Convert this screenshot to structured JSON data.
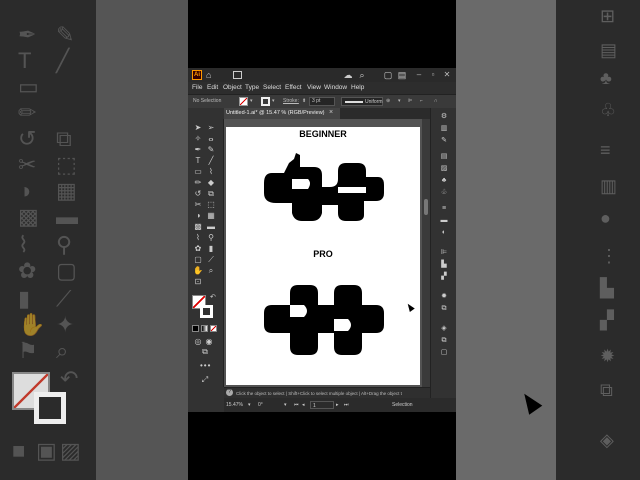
{
  "app": {
    "logo": "Ai",
    "menu": [
      "File",
      "Edit",
      "Object",
      "Type",
      "Select",
      "Effect",
      "View",
      "Window",
      "Help"
    ],
    "control_bar": {
      "selection_label": "No Selection",
      "stroke_label": "Stroke:",
      "stroke_value": "3 pt",
      "profile_label": "Uniform"
    },
    "document_tab": {
      "label": "Untitled-1.ai* @ 15.47 % (RGB/Preview)",
      "close": "×"
    },
    "artboard": {
      "heading_top": "BEGINNER",
      "heading_bottom": "PRO"
    },
    "hint": {
      "icon": "?",
      "text": "Click the object to select  |  Shift+Click to select multiple object  |  Alt+Drag the object t"
    },
    "status": {
      "zoom": "15.47%",
      "rotation": "0°",
      "artboard_number": "1",
      "mode": "Selection"
    },
    "colors": {
      "accent": "#ff9a00",
      "window_bg": "#323232",
      "canvas_bg": "#535353",
      "artboard_bg": "#ffffff"
    },
    "icons": {
      "home": "home-icon",
      "search": "search-icon",
      "shape": "puzzle-shape-icon",
      "selection_cursor": "arrow-cursor-icon"
    }
  }
}
